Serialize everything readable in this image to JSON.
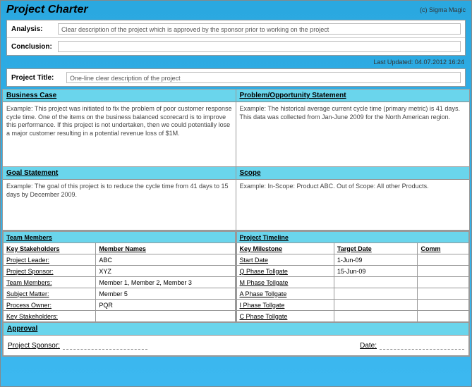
{
  "header": {
    "title": "Project Charter",
    "copyright": "(c) Sigma Magic"
  },
  "top": {
    "analysis_label": "Analysis:",
    "analysis_text": "Clear description of the project which is approved by the sponsor prior to working on the project",
    "conclusion_label": "Conclusion:",
    "conclusion_text": "",
    "last_updated": "Last Updated: 04.07.2012 16:24",
    "project_title_label": "Project Title:",
    "project_title_text": "One-line clear description of the project"
  },
  "quads": {
    "business_case": {
      "header": "Business Case",
      "body": "Example: This project was initiated to fix the problem of poor customer response cycle time. One of the items on the business balanced scorecard is to improve this performance. If this project is not undertaken, then we could potentially lose a major customer resulting in a potential revenue loss of $1M."
    },
    "problem": {
      "header": "Problem/Opportunity Statement",
      "body": "Example: The historical average current cycle time (primary metric) is 41 days. This data was collected from Jan-June 2009 for the North American region."
    },
    "goal": {
      "header": "Goal Statement",
      "body": "Example: The goal of this project is to reduce the cycle time from 41 days to 15 days by December 2009."
    },
    "scope": {
      "header": "Scope",
      "body": "Example: In-Scope: Product ABC. Out of Scope: All other Products."
    }
  },
  "team": {
    "header": "Team Members",
    "col1": "Key Stakeholders",
    "col2": "Member Names",
    "rows": [
      {
        "role": "Project Leader:",
        "names": "ABC"
      },
      {
        "role": "Project Sponsor:",
        "names": "XYZ"
      },
      {
        "role": "Team Members:",
        "names": "Member 1, Member 2, Member 3"
      },
      {
        "role": "Subject Matter:",
        "names": "Member 5"
      },
      {
        "role": "Process Owner:",
        "names": "PQR"
      },
      {
        "role": "Key Stakeholders:",
        "names": ""
      }
    ]
  },
  "timeline": {
    "header": "Project Timeline",
    "col1": "Key Milestone",
    "col2": "Target Date",
    "col3": "Comm",
    "rows": [
      {
        "m": "Start Date",
        "d": "1-Jun-09"
      },
      {
        "m": "Q Phase Tollgate",
        "d": "15-Jun-09"
      },
      {
        "m": "M Phase Tollgate",
        "d": ""
      },
      {
        "m": "A Phase Tollgate",
        "d": ""
      },
      {
        "m": "I Phase Tollgate",
        "d": ""
      },
      {
        "m": "C Phase Tollgate",
        "d": ""
      }
    ]
  },
  "approval": {
    "header": "Approval",
    "sponsor": "Project Sponsor:",
    "date": "Date:"
  }
}
